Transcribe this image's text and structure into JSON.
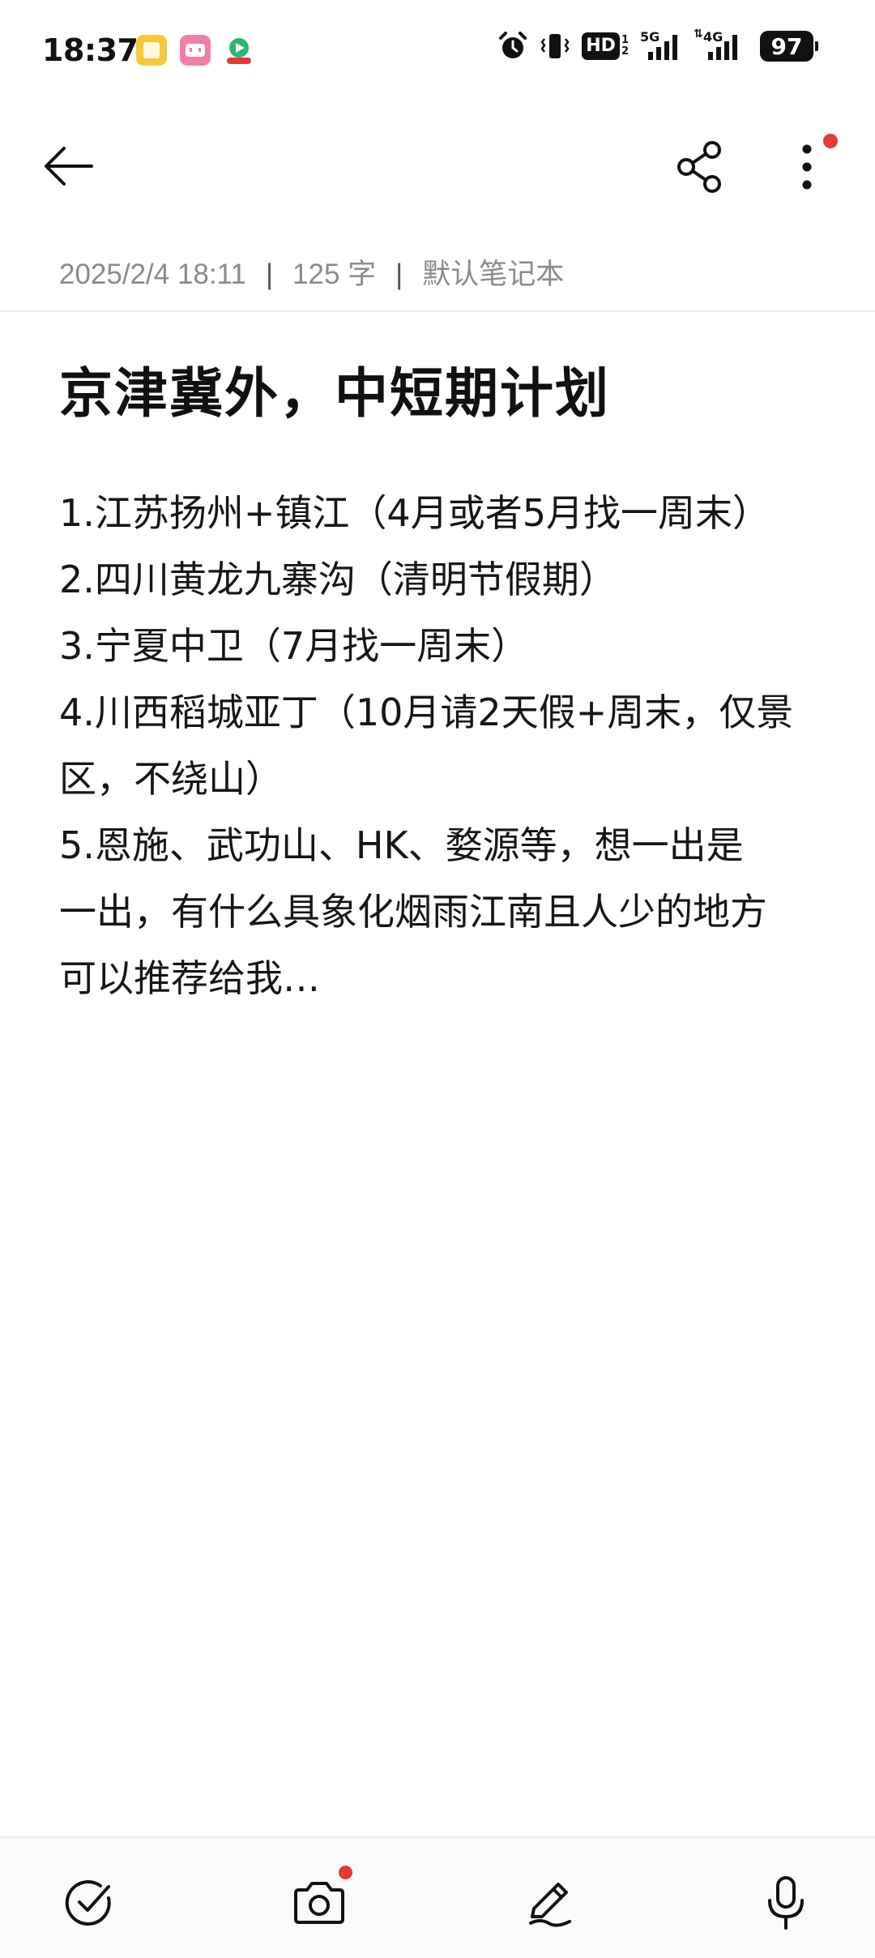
{
  "status_bar": {
    "time": "18:37",
    "app_icons": [
      "notes-app-icon",
      "bilibili-app-icon",
      "video-app-icon"
    ],
    "indicators": [
      "alarm-icon",
      "vibrate-icon",
      "hd-voice-icon",
      "signal-5g-icon",
      "signal-4g-icon"
    ],
    "hd_label": "HD",
    "net_5g": "5G",
    "net_4g": "4G",
    "battery": "97"
  },
  "app_bar": {
    "back_icon": "arrow-left-icon",
    "share_icon": "share-icon",
    "more_icon": "more-vertical-icon",
    "notification_dot_color": "#e53935"
  },
  "meta": {
    "date": "2025/2/4 18:11",
    "word_count": "125 字",
    "notebook": "默认笔记本",
    "separator": "|"
  },
  "note": {
    "title": "京津冀外，中短期计划",
    "lines": [
      "1.江苏扬州+镇江（4月或者5月找一周末）",
      "2.四川黄龙九寨沟（清明节假期）",
      "3.宁夏中卫（7月找一周末）",
      "4.川西稻城亚丁（10月请2天假+周末，仅景",
      "区，不绕山）",
      "5.恩施、武功山、HK、婺源等，想一出是",
      "一出，有什么具象化烟雨江南且人少的地方",
      "可以推荐给我…"
    ]
  },
  "bottom_toolbar": {
    "items": [
      "checklist-icon",
      "camera-icon",
      "pen-icon",
      "microphone-icon"
    ]
  }
}
